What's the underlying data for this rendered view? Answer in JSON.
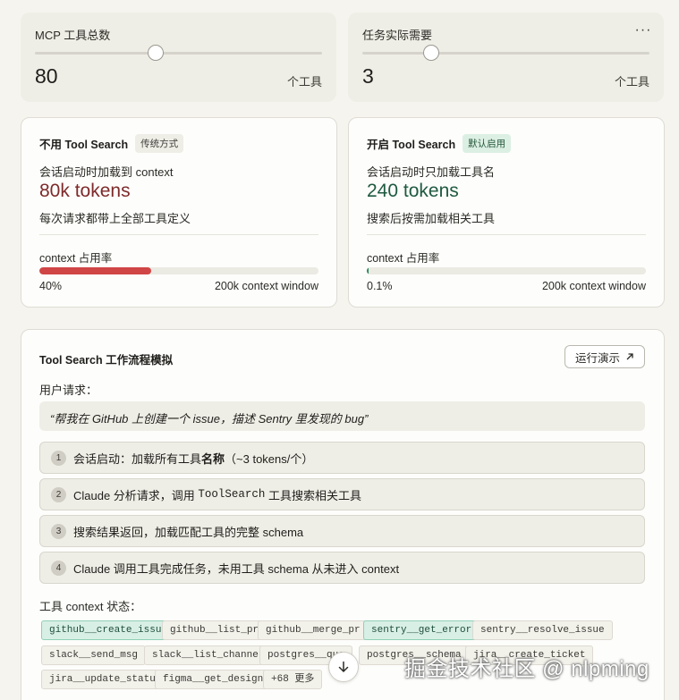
{
  "sliders": [
    {
      "label": "MCP 工具总数",
      "value": "80",
      "unit": "个工具",
      "fraction": 0.42
    },
    {
      "label": "任务实际需要",
      "value": "3",
      "unit": "个工具",
      "fraction": 0.24
    }
  ],
  "more_label": "···",
  "compare": [
    {
      "title": "不用 Tool Search",
      "badge": "传统方式",
      "line1": "会话启动时加载到 context",
      "big": "80k tokens",
      "line2": "每次请求都带上全部工具定义",
      "ctx_label": "context 占用率",
      "pct": "40%",
      "fraction": 0.4,
      "window": "200k context window",
      "accent": "#d04545"
    },
    {
      "title": "开启 Tool Search",
      "badge": "默认启用",
      "line1": "会话启动时只加载工具名",
      "big": "240 tokens",
      "line2": "搜索后按需加载相关工具",
      "ctx_label": "context 占用率",
      "pct": "0.1%",
      "fraction": 0.004,
      "window": "200k context window",
      "accent": "#2a8a5f"
    }
  ],
  "flow": {
    "title": "Tool Search 工作流程模拟",
    "run_label": "运行演示",
    "user_req_label": "用户请求：",
    "quote": "“帮我在 GitHub 上创建一个 issue，描述 Sentry 里发现的 bug”",
    "steps": [
      {
        "n": "1",
        "pre": "会话启动：加载所有工具",
        "bold": "名称",
        "post": "（~3 tokens/个）"
      },
      {
        "n": "2",
        "pre": "Claude 分析请求，调用 ",
        "code": "ToolSearch",
        "post": " 工具搜索相关工具"
      },
      {
        "n": "3",
        "text": "搜索结果返回，加载匹配工具的完整 schema"
      },
      {
        "n": "4",
        "text": "Claude 调用工具完成任务，未用工具 schema 从未进入 context"
      }
    ],
    "state_label": "工具 context 状态：",
    "chips_row1": [
      "github__create_issue",
      "github__list_prs",
      "github__merge_pr",
      "sentry__get_errors",
      "sentry__resolve_issue"
    ],
    "chips_row2": [
      "slack__send_msg",
      "slack__list_channels",
      "postgres__que",
      "postgres__schema",
      "jira__create_ticket"
    ],
    "chips_row3": [
      "jira__update_status",
      "figma__get_design",
      "+68 更多"
    ],
    "active_chips": [
      "github__create_issue",
      "sentry__get_errors"
    ]
  },
  "watermark": "掘金技术社区 @ nlpming"
}
